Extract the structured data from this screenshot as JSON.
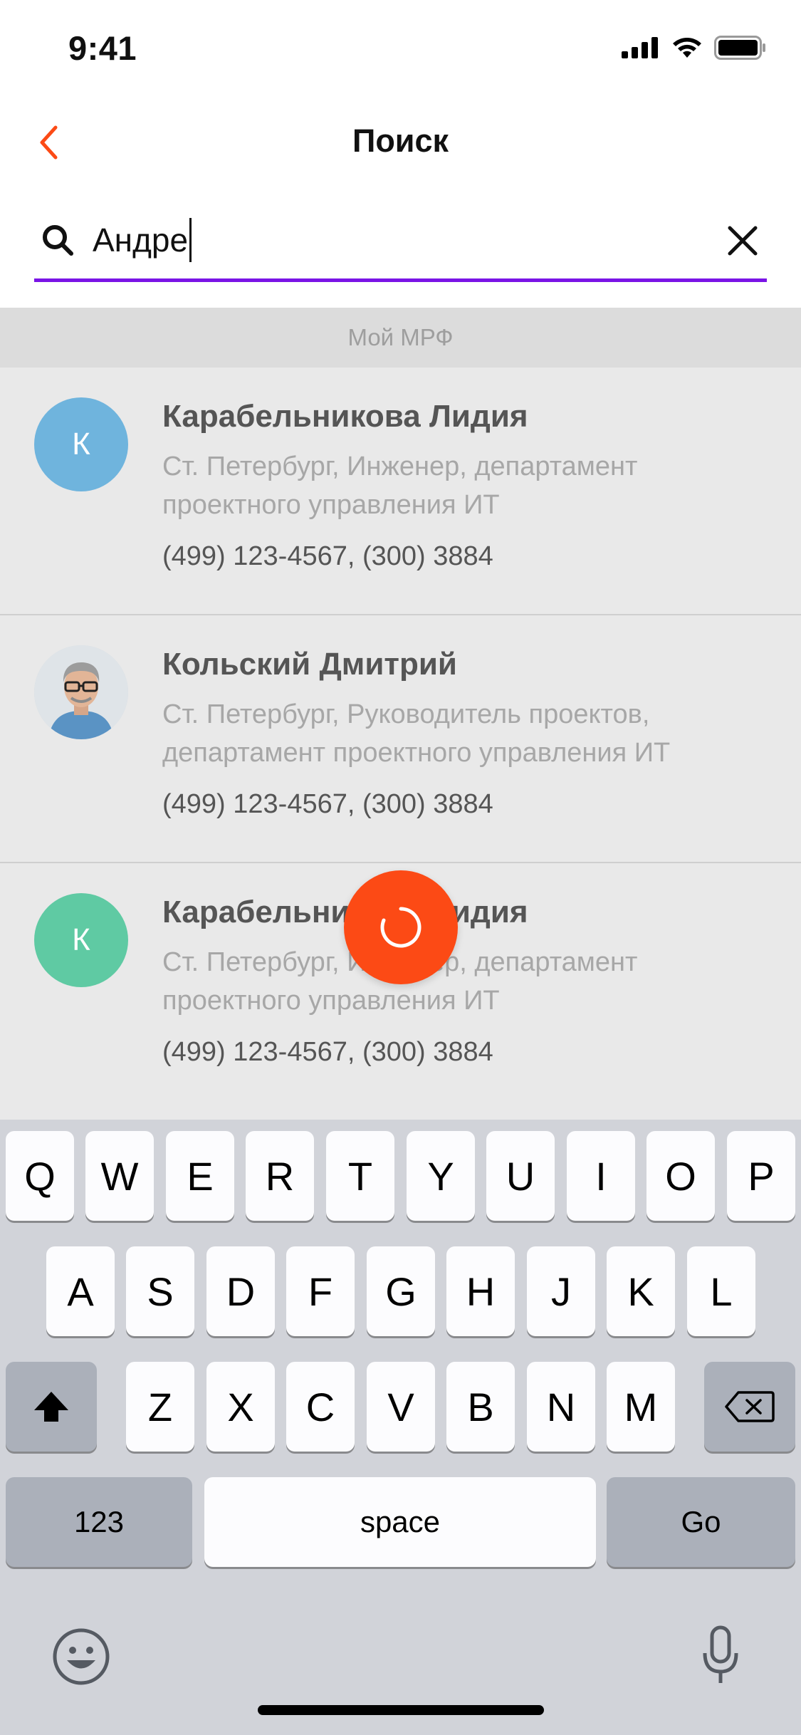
{
  "status_bar": {
    "time": "9:41"
  },
  "nav": {
    "title": "Поиск"
  },
  "search": {
    "value": "Андре"
  },
  "results": {
    "section_title": "Мой МРФ",
    "contacts": [
      {
        "initial": "К",
        "avatar_color": "#6fb4dd",
        "name": "Карабельникова Лидия",
        "desc": "Ст. Петербург, Инженер, департамент проектного управления ИТ",
        "phone": "(499) 123-4567, (300) 3884"
      },
      {
        "initial": "",
        "avatar_color": "#cfd6dc",
        "name": "Кольский Дмитрий",
        "desc": "Ст. Петербург, Руководитель проектов, департамент проектного управления ИТ",
        "phone": "(499) 123-4567, (300) 3884"
      },
      {
        "initial": "К",
        "avatar_color": "#5fcaa3",
        "name": "Карабельникова Лидия",
        "desc": "Ст. Петербург, Инженер, департамент проектного управления ИТ",
        "phone": "(499) 123-4567, (300) 3884"
      }
    ]
  },
  "keyboard": {
    "row1": [
      "Q",
      "W",
      "E",
      "R",
      "T",
      "Y",
      "U",
      "I",
      "O",
      "P"
    ],
    "row2": [
      "A",
      "S",
      "D",
      "F",
      "G",
      "H",
      "J",
      "K",
      "L"
    ],
    "row3": [
      "Z",
      "X",
      "C",
      "V",
      "B",
      "N",
      "M"
    ],
    "numbers_label": "123",
    "space_label": "space",
    "go_label": "Go"
  },
  "colors": {
    "accent": "#fc4a15",
    "search_underline": "#7a14e6"
  }
}
